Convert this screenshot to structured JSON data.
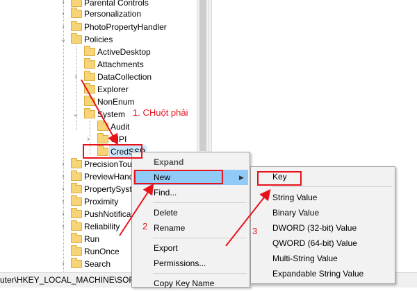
{
  "tree": {
    "items": [
      {
        "label": "Parental Controls"
      },
      {
        "label": "Personalization"
      },
      {
        "label": "PhotoPropertyHandler"
      },
      {
        "label": "Policies"
      },
      {
        "label": "ActiveDesktop"
      },
      {
        "label": "Attachments"
      },
      {
        "label": "DataCollection"
      },
      {
        "label": "Explorer"
      },
      {
        "label": "NonEnum"
      },
      {
        "label": "System"
      },
      {
        "label": "Audit"
      },
      {
        "label": "UIPI"
      },
      {
        "label": "CredSSP"
      },
      {
        "label": "PrecisionTou"
      },
      {
        "label": "PreviewHand"
      },
      {
        "label": "PropertySyst"
      },
      {
        "label": "Proximity"
      },
      {
        "label": "PushNotificat"
      },
      {
        "label": "Reliability"
      },
      {
        "label": "Run"
      },
      {
        "label": "RunOnce"
      },
      {
        "label": "Search"
      }
    ]
  },
  "status_bar": {
    "path": "uter\\HKEY_LOCAL_MACHINE\\SOFT"
  },
  "context_menu": {
    "items": [
      {
        "label": "Expand"
      },
      {
        "label": "New"
      },
      {
        "label": "Find..."
      },
      {
        "label": "Delete"
      },
      {
        "label": "Rename"
      },
      {
        "label": "Export"
      },
      {
        "label": "Permissions..."
      },
      {
        "label": "Copy Key Name"
      }
    ]
  },
  "submenu": {
    "items": [
      {
        "label": "Key"
      },
      {
        "label": "String Value"
      },
      {
        "label": "Binary Value"
      },
      {
        "label": "DWORD (32-bit) Value"
      },
      {
        "label": "QWORD (64-bit) Value"
      },
      {
        "label": "Multi-String Value"
      },
      {
        "label": "Expandable String Value"
      }
    ]
  },
  "annotations": {
    "step1": "1. CHuột phải",
    "step2": "2",
    "step3": "3",
    "color": "#e8121b"
  }
}
